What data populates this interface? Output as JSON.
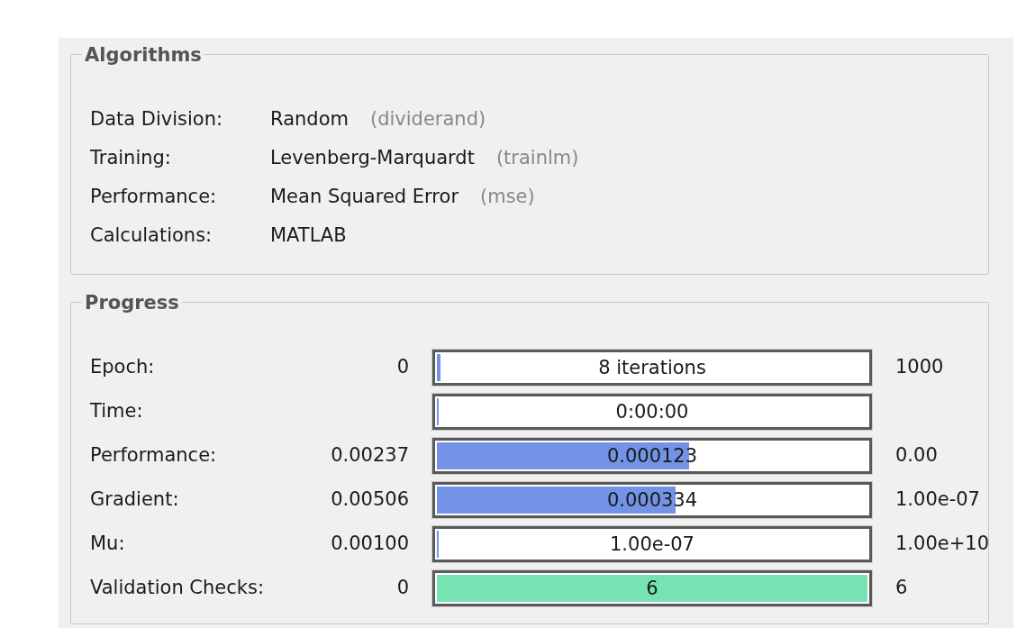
{
  "algorithms": {
    "title": "Algorithms",
    "rows": [
      {
        "label": "Data Division:",
        "value": "Random",
        "note": "(dividerand)"
      },
      {
        "label": "Training:",
        "value": "Levenberg-Marquardt",
        "note": "(trainlm)"
      },
      {
        "label": "Performance:",
        "value": "Mean Squared Error",
        "note": "(mse)"
      },
      {
        "label": "Calculations:",
        "value": "MATLAB"
      }
    ]
  },
  "progress": {
    "title": "Progress",
    "rows": [
      {
        "label": "Epoch:",
        "min": "0",
        "reading": "8 iterations",
        "max": "1000",
        "level": 0.008,
        "color": "#7393e6"
      },
      {
        "label": "Time:",
        "reading": "0:00:00",
        "level": 0,
        "color": "#7393e6"
      },
      {
        "label": "Performance:",
        "min": "0.00237",
        "reading": "0.000123",
        "max": "0.00",
        "level": 0.585,
        "color": "#7393e6"
      },
      {
        "label": "Gradient:",
        "min": "0.00506",
        "reading": "0.000334",
        "max": "1.00e-07",
        "level": 0.555,
        "color": "#7393e6"
      },
      {
        "label": "Mu:",
        "min": "0.00100",
        "reading": "1.00e-07",
        "max": "1.00e+10",
        "level": 0,
        "color": "#7393e6"
      },
      {
        "label": "Validation Checks:",
        "min": "0",
        "reading": "6",
        "max": "6",
        "level": 1,
        "color": "#77e3b3"
      }
    ]
  }
}
